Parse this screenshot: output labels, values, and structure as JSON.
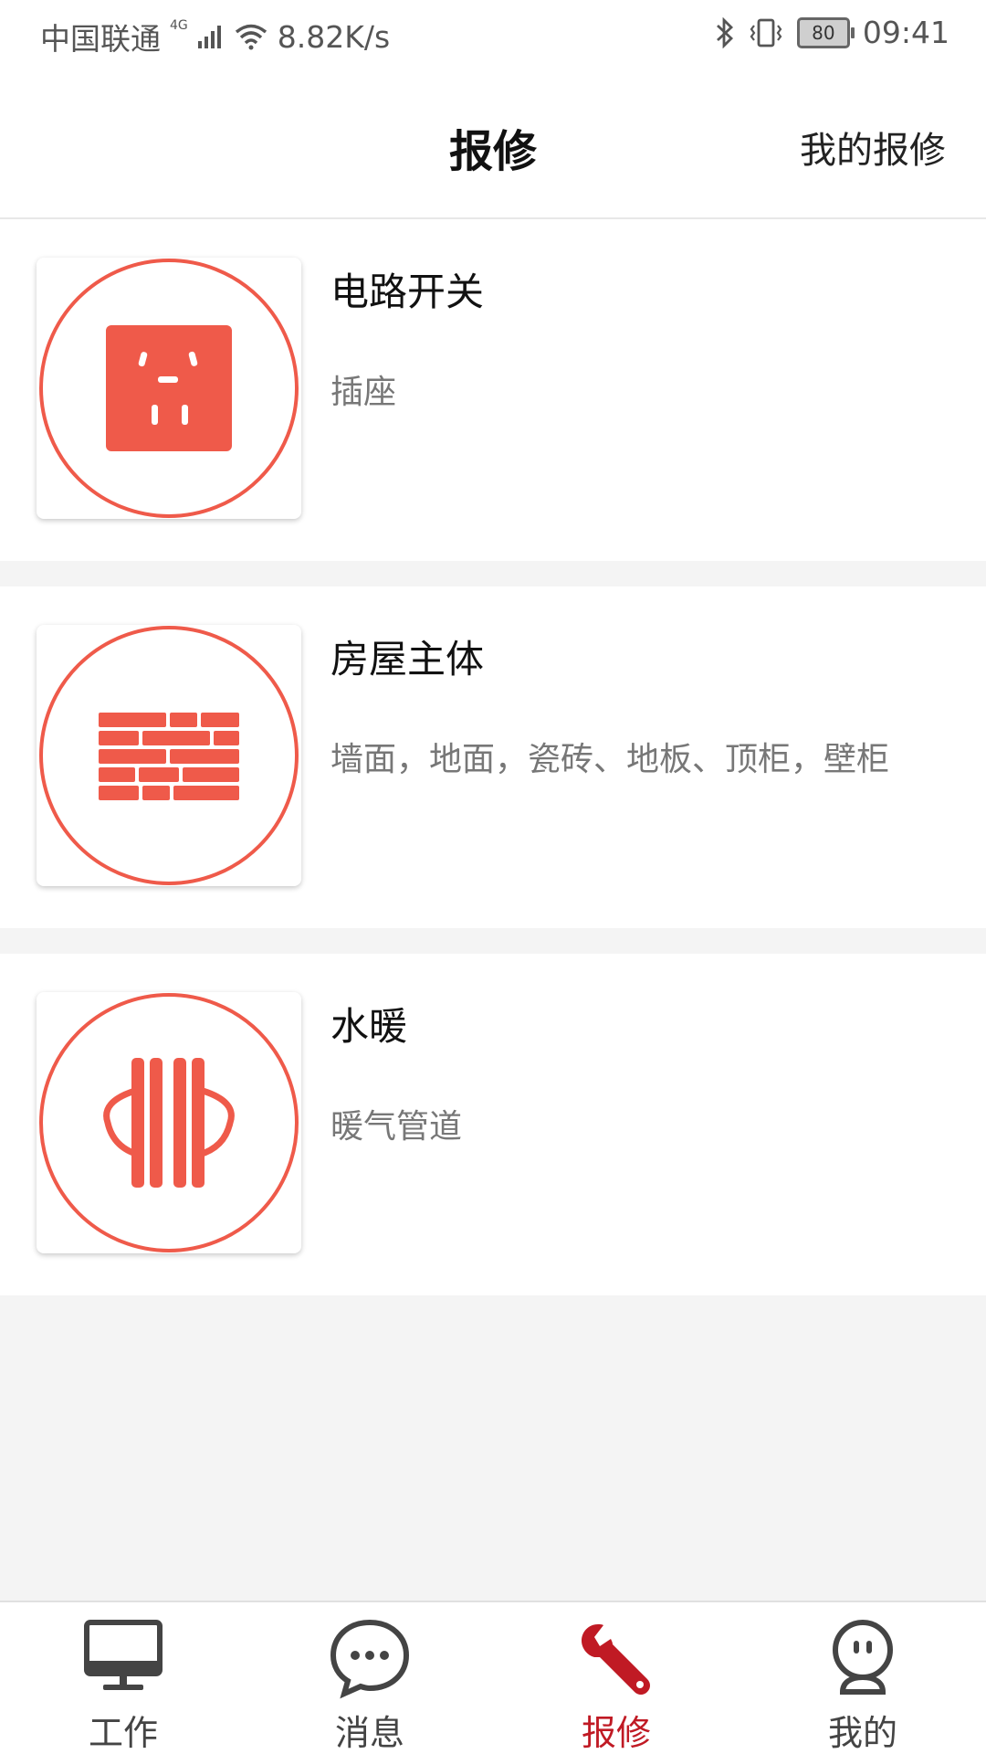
{
  "status_bar": {
    "carrier": "中国联通",
    "network": "4G",
    "speed": "8.82K/s",
    "battery": "80",
    "time": "09:41"
  },
  "header": {
    "title": "报修",
    "action_label": "我的报修"
  },
  "categories": [
    {
      "name": "电路开关",
      "desc": "插座",
      "icon": "socket-icon"
    },
    {
      "name": "房屋主体",
      "desc": "墙面，地面，瓷砖、地板、顶柜，壁柜",
      "icon": "brick-wall-icon"
    },
    {
      "name": "水暖",
      "desc": "暖气管道",
      "icon": "radiator-icon"
    }
  ],
  "bottom_nav": [
    {
      "label": "工作",
      "icon": "monitor-icon",
      "active": false
    },
    {
      "label": "消息",
      "icon": "chat-bubble-icon",
      "active": false
    },
    {
      "label": "报修",
      "icon": "wrench-icon",
      "active": true
    },
    {
      "label": "我的",
      "icon": "profile-icon",
      "active": false
    }
  ],
  "colors": {
    "accent": "#c01a24",
    "icon_red": "#ef5a4a"
  }
}
